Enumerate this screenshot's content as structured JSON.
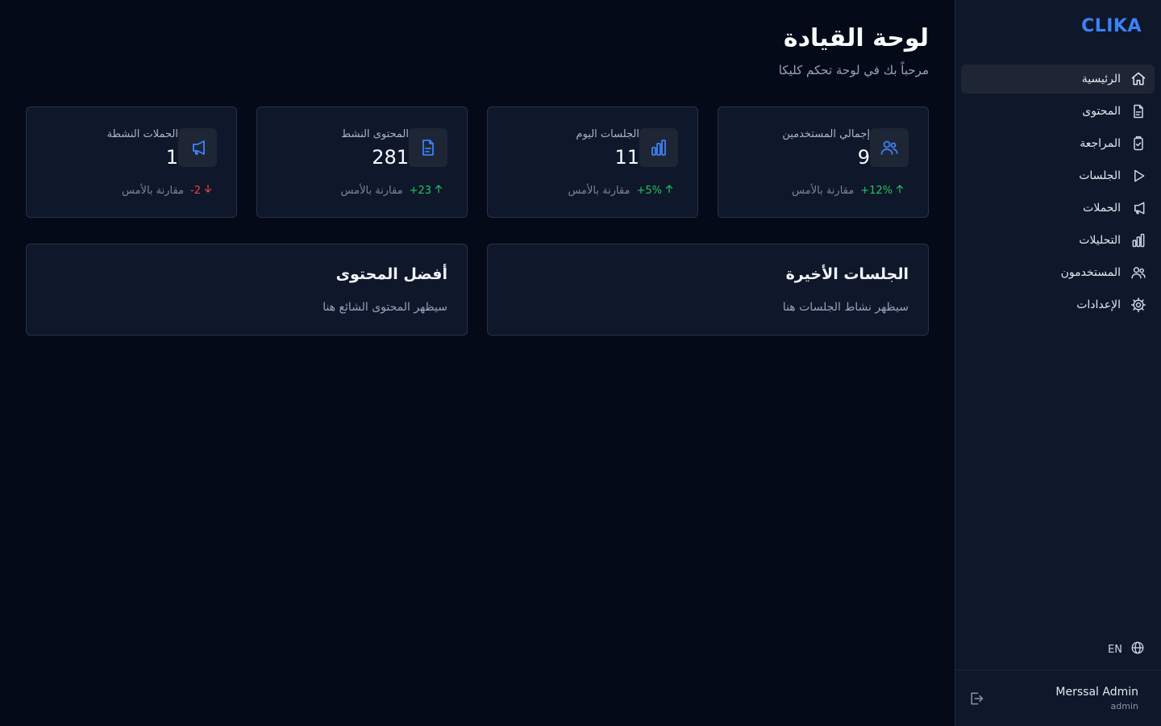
{
  "brand": "CLIKA",
  "nav": {
    "items": [
      {
        "label": "الرئيسية",
        "icon": "home-icon",
        "active": true
      },
      {
        "label": "المحتوى",
        "icon": "document-icon"
      },
      {
        "label": "المراجعة",
        "icon": "clipboard-check-icon"
      },
      {
        "label": "الجلسات",
        "icon": "play-icon"
      },
      {
        "label": "الحملات",
        "icon": "megaphone-icon"
      },
      {
        "label": "التحليلات",
        "icon": "bar-chart-icon"
      },
      {
        "label": "المستخدمون",
        "icon": "users-icon"
      },
      {
        "label": "الإعدادات",
        "icon": "gear-icon"
      }
    ]
  },
  "language": "EN",
  "user": {
    "name": "Merssal Admin",
    "role": "admin"
  },
  "header": {
    "title": "لوحة القيادة",
    "subtitle": "مرحباً بك في لوحة تحكم كليكا"
  },
  "stats": [
    {
      "label": "إجمالي المستخدمين",
      "value": "9",
      "delta": "+12%",
      "trend": "up",
      "compare": "مقارنة بالأمس",
      "icon": "users-icon"
    },
    {
      "label": "الجلسات اليوم",
      "value": "11",
      "delta": "+5%",
      "trend": "up",
      "compare": "مقارنة بالأمس",
      "icon": "bar-chart-icon"
    },
    {
      "label": "المحتوى النشط",
      "value": "281",
      "delta": "+23",
      "trend": "up",
      "compare": "مقارنة بالأمس",
      "icon": "document-icon"
    },
    {
      "label": "الحملات النشطة",
      "value": "1",
      "delta": "-2",
      "trend": "down",
      "compare": "مقارنة بالأمس",
      "icon": "megaphone-icon"
    }
  ],
  "panels": [
    {
      "title": "الجلسات الأخيرة",
      "description": "سيظهر نشاط الجلسات هنا"
    },
    {
      "title": "أفضل المحتوى",
      "description": "سيظهر المحتوى الشائع هنا"
    }
  ],
  "colors": {
    "accent": "#3b82f6",
    "up": "#22c55e",
    "down": "#ef4444",
    "background": "#050a18",
    "card": "#0f172a"
  }
}
